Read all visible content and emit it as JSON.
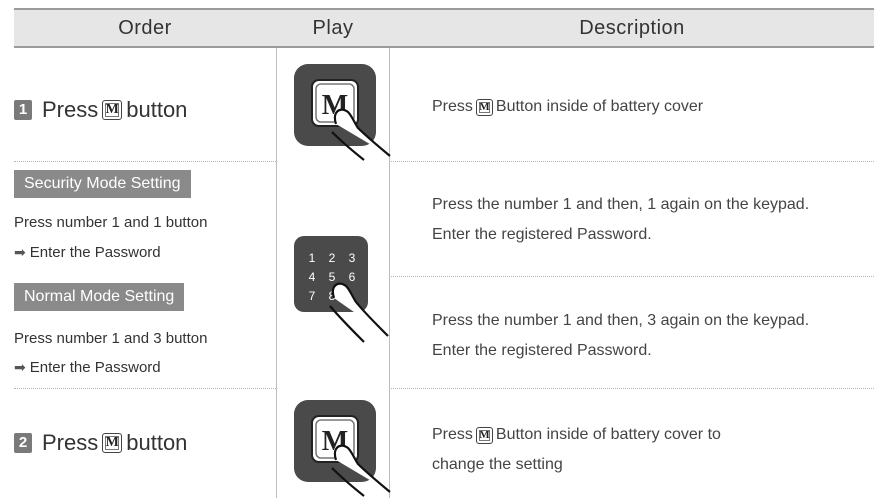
{
  "header": {
    "order": "Order",
    "play": "Play",
    "description": "Description"
  },
  "step1": {
    "number": "1",
    "label_pre": "Press",
    "m_glyph": "M",
    "label_post": "button",
    "desc_pre": "Press",
    "desc_post": "Button inside of battery cover"
  },
  "security": {
    "title": "Security Mode Setting",
    "line1": "Press number 1 and 1 button",
    "line2": "Enter the Password",
    "desc1": "Press the number 1 and then, 1 again on the keypad.",
    "desc2": "Enter the registered Password."
  },
  "normal": {
    "title": "Normal Mode Setting",
    "line1": "Press number 1 and 3 button",
    "line2": "Enter the Password",
    "desc1": "Press the number 1 and then, 3 again on the keypad.",
    "desc2": "Enter the registered Password."
  },
  "keypad": {
    "keys": [
      "1",
      "2",
      "3",
      "4",
      "5",
      "6",
      "7",
      "8"
    ]
  },
  "step2": {
    "number": "2",
    "label_pre": "Press",
    "m_glyph": "M",
    "label_post": "button",
    "desc_pre": "Press",
    "desc_line1_post": "Button inside of battery cover to",
    "desc_line2": "change the setting"
  },
  "icons": {
    "arrow": "right-arrow-icon",
    "hand": "pointing-finger-icon",
    "m_button": "m-button-icon"
  },
  "colors": {
    "header_bg": "#e6e6e6",
    "pill_bg": "#8a8a8a",
    "device_dark": "#4a4a4a"
  }
}
